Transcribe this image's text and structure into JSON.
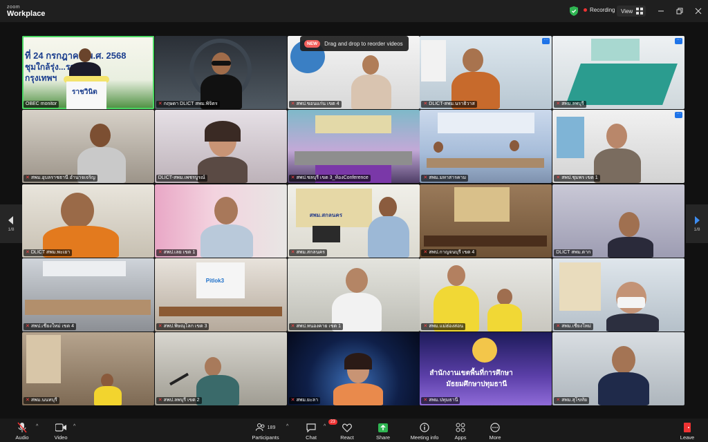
{
  "app": {
    "brand_small": "zoom",
    "brand_name": "Workplace"
  },
  "titlebar": {
    "recording_label": "Recording",
    "view_label": "View"
  },
  "toast": {
    "badge": "NEW",
    "text": "Drag and drop to reorder videos"
  },
  "pager": {
    "left": "1/8",
    "right": "1/8"
  },
  "tiles": [
    {
      "name": "OBEC monitor"
    },
    {
      "name": "กฤษดา DLICT สพม.พิจิตร"
    },
    {
      "name": "สพป.ขอนแก่น เขต 4"
    },
    {
      "name": "DLICT-สพม.นราธิวาส"
    },
    {
      "name": "สพม.ลพบุรี"
    },
    {
      "name": "สพม.อุบลราชธานี อำนาจเจริญ"
    },
    {
      "name": "DLICT-สพม.เพชรบูรณ์"
    },
    {
      "name": "สพป.ชลบุรี เขต 3_ห้องConference"
    },
    {
      "name": "สพม.มหาสารคาม"
    },
    {
      "name": "สพป.ชุมพร เขต 1"
    },
    {
      "name": "DLICT สพม.พะเยา"
    },
    {
      "name": "สพป.เลย เขต 1"
    },
    {
      "name": "สพม.สกลนคร"
    },
    {
      "name": "สพป.กาญจนบุรี เขต 4"
    },
    {
      "name": "DLICT สพม.ตาก"
    },
    {
      "name": "สพป.เชียงใหม่ เขต 4"
    },
    {
      "name": "สพป.พิษณุโลก เขต 3"
    },
    {
      "name": "สพป.หนองคาย เขต 1"
    },
    {
      "name": "สพม.แม่ฮ่องสอน"
    },
    {
      "name": "สพม.เชียงใหม่"
    },
    {
      "name": "สพม.นนทบุรี"
    },
    {
      "name": "สพป.ลพบุรี เขต 2"
    },
    {
      "name": "สพม.ยะลา"
    },
    {
      "name": "สพม.ปทุมธานี"
    },
    {
      "name": "สพม.สุโขทัย"
    }
  ],
  "banners": {
    "tile1_line1": "ที่ 24 กรกฎาคม พ.ศ. 2568",
    "tile1_line2": "ชุมใกล้รุ่ง...ราชวินิต",
    "tile1_line3": "กรุงเทพฯ",
    "tile1_podium": "ราชวินิต",
    "tile13_sign": "สพม.สกลนคร",
    "tile17_sign": "Pitlok3",
    "tile24_line1": "สำนักงานเขตพื้นที่การศึกษา",
    "tile24_line2": "มัธยมศึกษาปทุมธานี"
  },
  "toolbar": {
    "audio": "Audio",
    "video": "Video",
    "participants": "Participants",
    "participants_count": "189",
    "chat": "Chat",
    "chat_badge": "23",
    "react": "React",
    "share": "Share",
    "meeting_info": "Meeting info",
    "apps": "Apps",
    "more": "More",
    "leave": "Leave"
  }
}
